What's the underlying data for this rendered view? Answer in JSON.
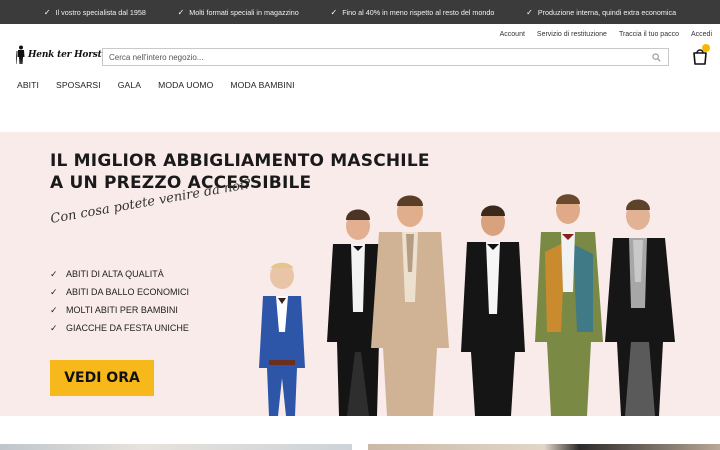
{
  "usp_bar": {
    "items": [
      "Il vostro specialista dal 1958",
      "Molti formati speciali in magazzino",
      "Fino al 40% in meno rispetto al resto del mondo",
      "Produzione interna, quindi extra economica"
    ]
  },
  "header": {
    "top_links": [
      "Account",
      "Servizio di restituzione",
      "Traccia il tuo pacco",
      "Accedi"
    ],
    "logo_text": "Henk ter Horst",
    "search": {
      "placeholder": "Cerca nell'intero negozio...",
      "value": ""
    },
    "nav": [
      "ABITI",
      "SPOSARSI",
      "GALA",
      "MODA UOMO",
      "MODA BAMBINI"
    ]
  },
  "hero": {
    "title_line1": "IL MIGLIOR ABBIGLIAMENTO MASCHILE",
    "title_line2": "A UN PREZZO ACCESSIBILE",
    "script": "Con cosa potete venire da noi?",
    "features": [
      "ABITI DI ALTA QUALITÀ",
      "ABITI DA BALLO ECONOMICI",
      "MOLTI ABITI PER BAMBINI",
      "GIACCHE DA FESTA UNICHE"
    ],
    "cta_label": "VEDI ORA"
  },
  "colors": {
    "usp_bg": "#3b3b3b",
    "hero_bg": "#f9ebe9",
    "cta": "#f7b81b",
    "cart_badge": "#f5b800"
  },
  "icons": [
    "check-icon",
    "logo-silhouette-icon",
    "search-icon",
    "shopping-bag-icon"
  ]
}
